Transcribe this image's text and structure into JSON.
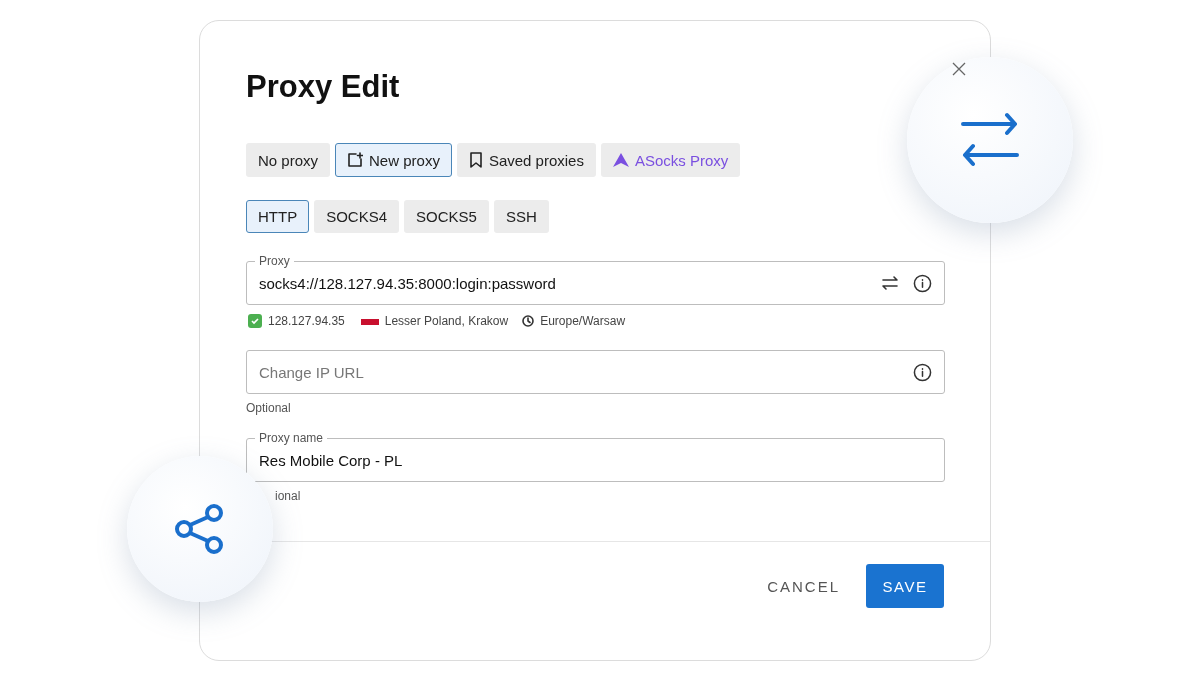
{
  "dialog": {
    "title": "Proxy Edit"
  },
  "source_tabs": [
    {
      "label": "No proxy",
      "kind": "plain",
      "selected": false
    },
    {
      "label": "New proxy",
      "kind": "new",
      "selected": true
    },
    {
      "label": "Saved proxies",
      "kind": "saved",
      "selected": false
    },
    {
      "label": "ASocks Proxy",
      "kind": "brand",
      "selected": false
    }
  ],
  "protocol_tabs": [
    {
      "label": "HTTP",
      "selected": true
    },
    {
      "label": "SOCKS4",
      "selected": false
    },
    {
      "label": "SOCKS5",
      "selected": false
    },
    {
      "label": "SSH",
      "selected": false
    }
  ],
  "proxy_field": {
    "label": "Proxy",
    "value": "socks4://128.127.94.35:8000:login:password"
  },
  "proxy_check": {
    "ip": "128.127.94.35",
    "verified": true,
    "location": "Lesser Poland, Krakow",
    "timezone": "Europe/Warsaw"
  },
  "change_ip_field": {
    "placeholder": "Change IP URL",
    "helper": "Optional"
  },
  "name_field": {
    "label": "Proxy name",
    "value": "Res Mobile Corp - PL",
    "helper": "ional"
  },
  "buttons": {
    "cancel": "CANCEL",
    "save": "SAVE"
  }
}
